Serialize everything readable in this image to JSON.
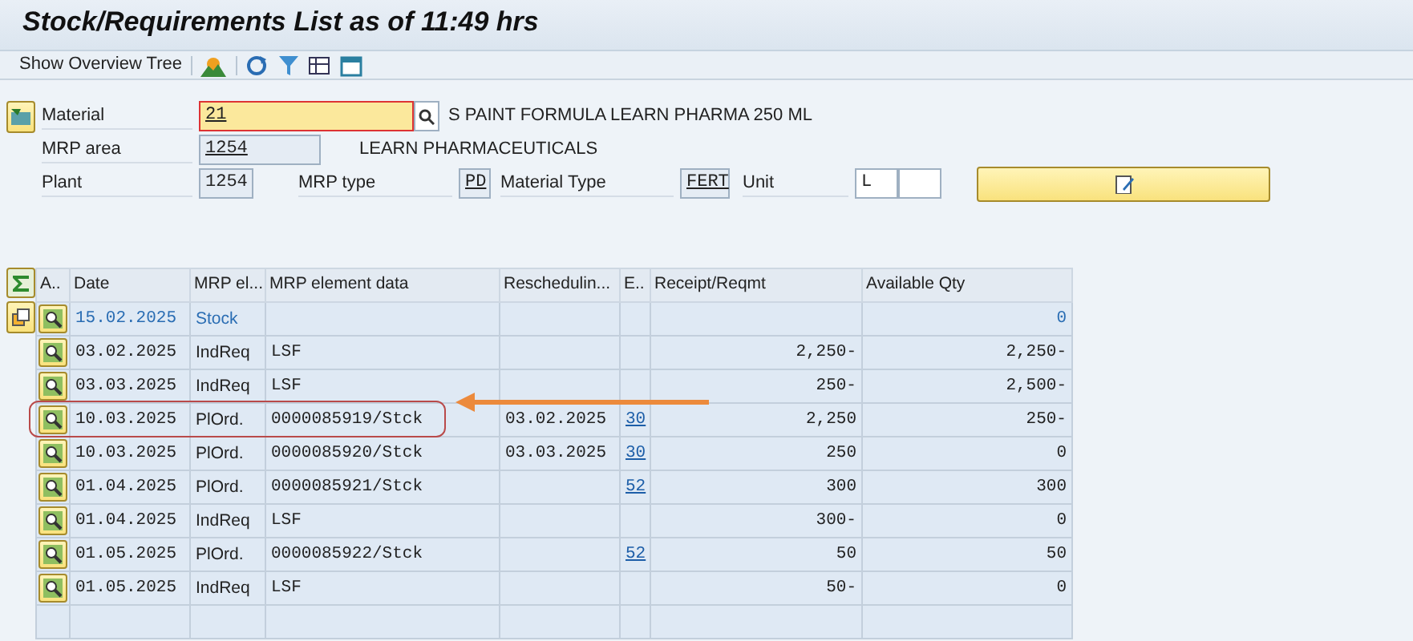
{
  "window": {
    "title": "Stock/Requirements List as of 11:49 hrs"
  },
  "toolbar": {
    "label": "Show Overview Tree"
  },
  "header": {
    "material": {
      "label": "Material",
      "value": "21",
      "description": "S PAINT FORMULA LEARN PHARMA 250 ML"
    },
    "mrp_area": {
      "label": "MRP area",
      "value": "1254",
      "description": "LEARN PHARMACEUTICALS"
    },
    "plant": {
      "label": "Plant",
      "value": "1254"
    },
    "mrp_type": {
      "label": "MRP type",
      "value": "PD"
    },
    "material_type": {
      "label": "Material Type",
      "value": "FERT"
    },
    "unit": {
      "label": "Unit",
      "value": "L"
    }
  },
  "table": {
    "columns": [
      "A..",
      "Date",
      "MRP el...",
      "MRP element data",
      "Reschedulin...",
      "E..",
      "Receipt/Reqmt",
      "Available Qty"
    ],
    "rows": [
      {
        "kind": "stock",
        "highlighted": false,
        "date": "15.02.2025",
        "element": "Stock",
        "data": "",
        "reschedule": "",
        "exception": "",
        "receipt": "",
        "available": "0"
      },
      {
        "kind": "item",
        "highlighted": false,
        "date": "03.02.2025",
        "element": "IndReq",
        "data": "LSF",
        "reschedule": "",
        "exception": "",
        "receipt": "2,250-",
        "available": "2,250-"
      },
      {
        "kind": "item",
        "highlighted": false,
        "date": "03.03.2025",
        "element": "IndReq",
        "data": "LSF",
        "reschedule": "",
        "exception": "",
        "receipt": "250-",
        "available": "2,500-"
      },
      {
        "kind": "item",
        "highlighted": true,
        "date": "10.03.2025",
        "element": "PlOrd.",
        "data": "0000085919/Stck",
        "reschedule": "03.02.2025",
        "exception": "30",
        "receipt": "2,250",
        "available": "250-"
      },
      {
        "kind": "item",
        "highlighted": false,
        "date": "10.03.2025",
        "element": "PlOrd.",
        "data": "0000085920/Stck",
        "reschedule": "03.03.2025",
        "exception": "30",
        "receipt": "250",
        "available": "0"
      },
      {
        "kind": "item",
        "highlighted": false,
        "date": "01.04.2025",
        "element": "PlOrd.",
        "data": "0000085921/Stck",
        "reschedule": "",
        "exception": "52",
        "receipt": "300",
        "available": "300"
      },
      {
        "kind": "item",
        "highlighted": false,
        "date": "01.04.2025",
        "element": "IndReq",
        "data": "LSF",
        "reschedule": "",
        "exception": "",
        "receipt": "300-",
        "available": "0"
      },
      {
        "kind": "item",
        "highlighted": false,
        "date": "01.05.2025",
        "element": "PlOrd.",
        "data": "0000085922/Stck",
        "reschedule": "",
        "exception": "52",
        "receipt": "50",
        "available": "50"
      },
      {
        "kind": "item",
        "highlighted": false,
        "date": "01.05.2025",
        "element": "IndReq",
        "data": "LSF",
        "reschedule": "",
        "exception": "",
        "receipt": "50-",
        "available": "0"
      }
    ]
  }
}
